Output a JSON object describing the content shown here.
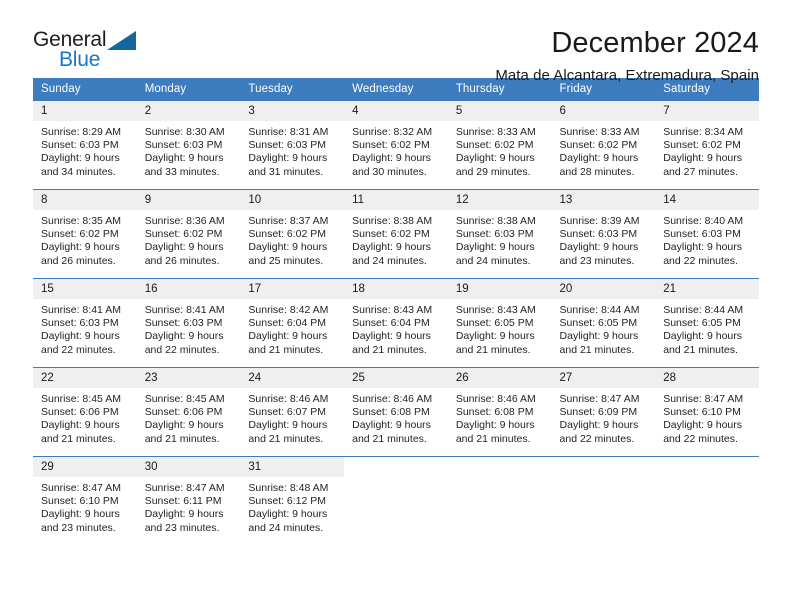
{
  "brand": {
    "name_top": "General",
    "name_bottom": "Blue",
    "accent_color": "#1c74c4",
    "triangle_color": "#14679c"
  },
  "header": {
    "title": "December 2024",
    "subtitle": "Mata de Alcantara, Extremadura, Spain"
  },
  "calendar": {
    "header_bg": "#3d7dbf",
    "daynum_bg": "#efefef",
    "weekday_headers": [
      "Sunday",
      "Monday",
      "Tuesday",
      "Wednesday",
      "Thursday",
      "Friday",
      "Saturday"
    ],
    "weeks": [
      [
        {
          "day": "1",
          "sunrise": "Sunrise: 8:29 AM",
          "sunset": "Sunset: 6:03 PM",
          "daylight_line1": "Daylight: 9 hours",
          "daylight_line2": "and 34 minutes."
        },
        {
          "day": "2",
          "sunrise": "Sunrise: 8:30 AM",
          "sunset": "Sunset: 6:03 PM",
          "daylight_line1": "Daylight: 9 hours",
          "daylight_line2": "and 33 minutes."
        },
        {
          "day": "3",
          "sunrise": "Sunrise: 8:31 AM",
          "sunset": "Sunset: 6:03 PM",
          "daylight_line1": "Daylight: 9 hours",
          "daylight_line2": "and 31 minutes."
        },
        {
          "day": "4",
          "sunrise": "Sunrise: 8:32 AM",
          "sunset": "Sunset: 6:02 PM",
          "daylight_line1": "Daylight: 9 hours",
          "daylight_line2": "and 30 minutes."
        },
        {
          "day": "5",
          "sunrise": "Sunrise: 8:33 AM",
          "sunset": "Sunset: 6:02 PM",
          "daylight_line1": "Daylight: 9 hours",
          "daylight_line2": "and 29 minutes."
        },
        {
          "day": "6",
          "sunrise": "Sunrise: 8:33 AM",
          "sunset": "Sunset: 6:02 PM",
          "daylight_line1": "Daylight: 9 hours",
          "daylight_line2": "and 28 minutes."
        },
        {
          "day": "7",
          "sunrise": "Sunrise: 8:34 AM",
          "sunset": "Sunset: 6:02 PM",
          "daylight_line1": "Daylight: 9 hours",
          "daylight_line2": "and 27 minutes."
        }
      ],
      [
        {
          "day": "8",
          "sunrise": "Sunrise: 8:35 AM",
          "sunset": "Sunset: 6:02 PM",
          "daylight_line1": "Daylight: 9 hours",
          "daylight_line2": "and 26 minutes."
        },
        {
          "day": "9",
          "sunrise": "Sunrise: 8:36 AM",
          "sunset": "Sunset: 6:02 PM",
          "daylight_line1": "Daylight: 9 hours",
          "daylight_line2": "and 26 minutes."
        },
        {
          "day": "10",
          "sunrise": "Sunrise: 8:37 AM",
          "sunset": "Sunset: 6:02 PM",
          "daylight_line1": "Daylight: 9 hours",
          "daylight_line2": "and 25 minutes."
        },
        {
          "day": "11",
          "sunrise": "Sunrise: 8:38 AM",
          "sunset": "Sunset: 6:02 PM",
          "daylight_line1": "Daylight: 9 hours",
          "daylight_line2": "and 24 minutes."
        },
        {
          "day": "12",
          "sunrise": "Sunrise: 8:38 AM",
          "sunset": "Sunset: 6:03 PM",
          "daylight_line1": "Daylight: 9 hours",
          "daylight_line2": "and 24 minutes."
        },
        {
          "day": "13",
          "sunrise": "Sunrise: 8:39 AM",
          "sunset": "Sunset: 6:03 PM",
          "daylight_line1": "Daylight: 9 hours",
          "daylight_line2": "and 23 minutes."
        },
        {
          "day": "14",
          "sunrise": "Sunrise: 8:40 AM",
          "sunset": "Sunset: 6:03 PM",
          "daylight_line1": "Daylight: 9 hours",
          "daylight_line2": "and 22 minutes."
        }
      ],
      [
        {
          "day": "15",
          "sunrise": "Sunrise: 8:41 AM",
          "sunset": "Sunset: 6:03 PM",
          "daylight_line1": "Daylight: 9 hours",
          "daylight_line2": "and 22 minutes."
        },
        {
          "day": "16",
          "sunrise": "Sunrise: 8:41 AM",
          "sunset": "Sunset: 6:03 PM",
          "daylight_line1": "Daylight: 9 hours",
          "daylight_line2": "and 22 minutes."
        },
        {
          "day": "17",
          "sunrise": "Sunrise: 8:42 AM",
          "sunset": "Sunset: 6:04 PM",
          "daylight_line1": "Daylight: 9 hours",
          "daylight_line2": "and 21 minutes."
        },
        {
          "day": "18",
          "sunrise": "Sunrise: 8:43 AM",
          "sunset": "Sunset: 6:04 PM",
          "daylight_line1": "Daylight: 9 hours",
          "daylight_line2": "and 21 minutes."
        },
        {
          "day": "19",
          "sunrise": "Sunrise: 8:43 AM",
          "sunset": "Sunset: 6:05 PM",
          "daylight_line1": "Daylight: 9 hours",
          "daylight_line2": "and 21 minutes."
        },
        {
          "day": "20",
          "sunrise": "Sunrise: 8:44 AM",
          "sunset": "Sunset: 6:05 PM",
          "daylight_line1": "Daylight: 9 hours",
          "daylight_line2": "and 21 minutes."
        },
        {
          "day": "21",
          "sunrise": "Sunrise: 8:44 AM",
          "sunset": "Sunset: 6:05 PM",
          "daylight_line1": "Daylight: 9 hours",
          "daylight_line2": "and 21 minutes."
        }
      ],
      [
        {
          "day": "22",
          "sunrise": "Sunrise: 8:45 AM",
          "sunset": "Sunset: 6:06 PM",
          "daylight_line1": "Daylight: 9 hours",
          "daylight_line2": "and 21 minutes."
        },
        {
          "day": "23",
          "sunrise": "Sunrise: 8:45 AM",
          "sunset": "Sunset: 6:06 PM",
          "daylight_line1": "Daylight: 9 hours",
          "daylight_line2": "and 21 minutes."
        },
        {
          "day": "24",
          "sunrise": "Sunrise: 8:46 AM",
          "sunset": "Sunset: 6:07 PM",
          "daylight_line1": "Daylight: 9 hours",
          "daylight_line2": "and 21 minutes."
        },
        {
          "day": "25",
          "sunrise": "Sunrise: 8:46 AM",
          "sunset": "Sunset: 6:08 PM",
          "daylight_line1": "Daylight: 9 hours",
          "daylight_line2": "and 21 minutes."
        },
        {
          "day": "26",
          "sunrise": "Sunrise: 8:46 AM",
          "sunset": "Sunset: 6:08 PM",
          "daylight_line1": "Daylight: 9 hours",
          "daylight_line2": "and 21 minutes."
        },
        {
          "day": "27",
          "sunrise": "Sunrise: 8:47 AM",
          "sunset": "Sunset: 6:09 PM",
          "daylight_line1": "Daylight: 9 hours",
          "daylight_line2": "and 22 minutes."
        },
        {
          "day": "28",
          "sunrise": "Sunrise: 8:47 AM",
          "sunset": "Sunset: 6:10 PM",
          "daylight_line1": "Daylight: 9 hours",
          "daylight_line2": "and 22 minutes."
        }
      ],
      [
        {
          "day": "29",
          "sunrise": "Sunrise: 8:47 AM",
          "sunset": "Sunset: 6:10 PM",
          "daylight_line1": "Daylight: 9 hours",
          "daylight_line2": "and 23 minutes."
        },
        {
          "day": "30",
          "sunrise": "Sunrise: 8:47 AM",
          "sunset": "Sunset: 6:11 PM",
          "daylight_line1": "Daylight: 9 hours",
          "daylight_line2": "and 23 minutes."
        },
        {
          "day": "31",
          "sunrise": "Sunrise: 8:48 AM",
          "sunset": "Sunset: 6:12 PM",
          "daylight_line1": "Daylight: 9 hours",
          "daylight_line2": "and 24 minutes."
        },
        {
          "day": "",
          "sunrise": "",
          "sunset": "",
          "daylight_line1": "",
          "daylight_line2": ""
        },
        {
          "day": "",
          "sunrise": "",
          "sunset": "",
          "daylight_line1": "",
          "daylight_line2": ""
        },
        {
          "day": "",
          "sunrise": "",
          "sunset": "",
          "daylight_line1": "",
          "daylight_line2": ""
        },
        {
          "day": "",
          "sunrise": "",
          "sunset": "",
          "daylight_line1": "",
          "daylight_line2": ""
        }
      ]
    ]
  }
}
